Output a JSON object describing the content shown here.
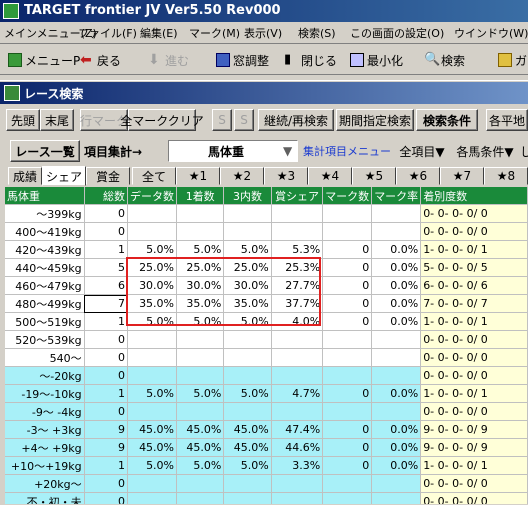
{
  "app_title": "TARGET frontier JV  Ver5.50  Rev000",
  "menu": [
    "メインメニュー(Z)",
    "ファイル(F)",
    "編集(E)",
    "マーク(M)",
    "表示(V)",
    "検索(S)",
    "この画面の設定(O)",
    "ウインドウ(W)"
  ],
  "toolbar": {
    "main_menu": "メニューP",
    "back": "戻る",
    "forward": "進む",
    "window_adjust": "窓調整",
    "close": "閉じる",
    "minimize": "最小化",
    "search": "検索",
    "ga": "ガ"
  },
  "window": {
    "title": "レース検索",
    "buttons": {
      "first": "先頭",
      "last": "末尾",
      "row_mark": "行マーク",
      "all_mark_clear": "全マーククリア",
      "s1": "S",
      "s2": "S",
      "continue_search": "継続/再検索",
      "period_search": "期間指定検索",
      "search_conditions": "検索条件",
      "all_flat": "各平地"
    },
    "race_list": "レース一覧",
    "item_agg": "項目集計→",
    "agg_item_value": "馬体重",
    "agg_menu": "集計項目メニュー",
    "all_items": "全項目▼",
    "each_cond": "各馬条件▼",
    "l_frag": "し"
  },
  "tabs": [
    "成績",
    "シェア",
    "賞金",
    "全て",
    "★1",
    "★2",
    "★3",
    "★4",
    "★5",
    "★6",
    "★7",
    "★8"
  ],
  "active_tab": 1,
  "grid": {
    "headers": [
      "馬体重",
      "総数",
      "データ数",
      "1着数",
      "3内数",
      "賞シェア",
      "マーク数",
      "マーク率",
      "着別度数"
    ],
    "rows": [
      {
        "label": "～399kg",
        "total": "0",
        "data": "",
        "w1": "",
        "w3": "",
        "share": "",
        "marks": "",
        "rate": "",
        "dist": "0- 0- 0- 0/ 0",
        "style": "w"
      },
      {
        "label": "400～419kg",
        "total": "0",
        "data": "",
        "w1": "",
        "w3": "",
        "share": "",
        "marks": "",
        "rate": "",
        "dist": "0- 0- 0- 0/ 0",
        "style": "w"
      },
      {
        "label": "420～439kg",
        "total": "1",
        "data": "5.0%",
        "w1": "5.0%",
        "w3": "5.0%",
        "share": "5.3%",
        "marks": "0",
        "rate": "0.0%",
        "dist": "1- 0- 0- 0/ 1",
        "style": "w"
      },
      {
        "label": "440～459kg",
        "total": "5",
        "data": "25.0%",
        "w1": "25.0%",
        "w3": "25.0%",
        "share": "25.3%",
        "marks": "0",
        "rate": "0.0%",
        "dist": "5- 0- 0- 0/ 5",
        "style": "w"
      },
      {
        "label": "460～479kg",
        "total": "6",
        "data": "30.0%",
        "w1": "30.0%",
        "w3": "30.0%",
        "share": "27.7%",
        "marks": "0",
        "rate": "0.0%",
        "dist": "6- 0- 0- 0/ 6",
        "style": "w"
      },
      {
        "label": "480～499kg",
        "total": "7",
        "data": "35.0%",
        "w1": "35.0%",
        "w3": "35.0%",
        "share": "37.7%",
        "marks": "0",
        "rate": "0.0%",
        "dist": "7- 0- 0- 0/ 7",
        "style": "w",
        "selected": true
      },
      {
        "label": "500～519kg",
        "total": "1",
        "data": "5.0%",
        "w1": "5.0%",
        "w3": "5.0%",
        "share": "4.0%",
        "marks": "0",
        "rate": "0.0%",
        "dist": "1- 0- 0- 0/ 1",
        "style": "w"
      },
      {
        "label": "520～539kg",
        "total": "0",
        "data": "",
        "w1": "",
        "w3": "",
        "share": "",
        "marks": "",
        "rate": "",
        "dist": "0- 0- 0- 0/ 0",
        "style": "w"
      },
      {
        "label": "540～",
        "total": "0",
        "data": "",
        "w1": "",
        "w3": "",
        "share": "",
        "marks": "",
        "rate": "",
        "dist": "0- 0- 0- 0/ 0",
        "style": "w"
      },
      {
        "label": "～-20kg",
        "total": "0",
        "data": "",
        "w1": "",
        "w3": "",
        "share": "",
        "marks": "",
        "rate": "",
        "dist": "0- 0- 0- 0/ 0",
        "style": "c"
      },
      {
        "label": "-19～-10kg",
        "total": "1",
        "data": "5.0%",
        "w1": "5.0%",
        "w3": "5.0%",
        "share": "4.7%",
        "marks": "0",
        "rate": "0.0%",
        "dist": "1- 0- 0- 0/ 1",
        "style": "c"
      },
      {
        "label": "-9～ -4kg",
        "total": "0",
        "data": "",
        "w1": "",
        "w3": "",
        "share": "",
        "marks": "",
        "rate": "",
        "dist": "0- 0- 0- 0/ 0",
        "style": "c"
      },
      {
        "label": "-3～ +3kg",
        "total": "9",
        "data": "45.0%",
        "w1": "45.0%",
        "w3": "45.0%",
        "share": "47.4%",
        "marks": "0",
        "rate": "0.0%",
        "dist": "9- 0- 0- 0/ 9",
        "style": "c"
      },
      {
        "label": "+4～ +9kg",
        "total": "9",
        "data": "45.0%",
        "w1": "45.0%",
        "w3": "45.0%",
        "share": "44.6%",
        "marks": "0",
        "rate": "0.0%",
        "dist": "9- 0- 0- 0/ 9",
        "style": "c"
      },
      {
        "label": "+10～+19kg",
        "total": "1",
        "data": "5.0%",
        "w1": "5.0%",
        "w3": "5.0%",
        "share": "3.3%",
        "marks": "0",
        "rate": "0.0%",
        "dist": "1- 0- 0- 0/ 1",
        "style": "c"
      },
      {
        "label": "+20kg～",
        "total": "0",
        "data": "",
        "w1": "",
        "w3": "",
        "share": "",
        "marks": "",
        "rate": "",
        "dist": "0- 0- 0- 0/ 0",
        "style": "c"
      },
      {
        "label": "不・初・未",
        "total": "0",
        "data": "",
        "w1": "",
        "w3": "",
        "share": "",
        "marks": "",
        "rate": "",
        "dist": "0- 0- 0- 0/ 0",
        "style": "c"
      }
    ]
  },
  "colors": {
    "header_green": "#1a8a3a",
    "cyan_rows": "#a8f0f8",
    "yellow_col": "#ffffd8",
    "highlight_red": "#e02020"
  }
}
